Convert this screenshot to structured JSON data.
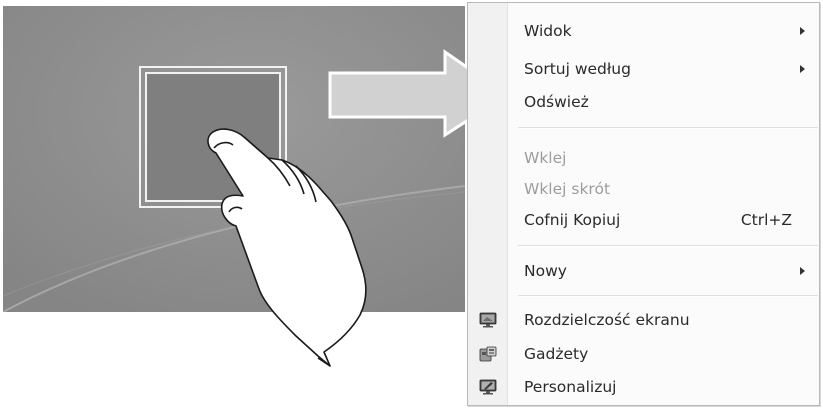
{
  "illustration": {
    "description_icons": [
      "touch-hand-icon",
      "arrow-right-icon"
    ]
  },
  "context_menu": {
    "items": [
      {
        "label": "Widok",
        "has_submenu": true,
        "enabled": true
      },
      {
        "label": "Sortuj według",
        "has_submenu": true,
        "enabled": true
      },
      {
        "label": "Odśwież",
        "has_submenu": false,
        "enabled": true
      },
      {
        "label": "Wklej",
        "has_submenu": false,
        "enabled": false
      },
      {
        "label": "Wklej skrót",
        "has_submenu": false,
        "enabled": false
      },
      {
        "label": "Cofnij Kopiuj",
        "shortcut": "Ctrl+Z",
        "has_submenu": false,
        "enabled": true
      },
      {
        "label": "Nowy",
        "has_submenu": true,
        "enabled": true
      },
      {
        "label": "Rozdzielczość ekranu",
        "icon": "screen-resolution-icon",
        "enabled": true
      },
      {
        "label": "Gadżety",
        "icon": "gadgets-icon",
        "enabled": true
      },
      {
        "label": "Personalizuj",
        "icon": "personalize-icon",
        "enabled": true
      }
    ]
  },
  "colors": {
    "menu_background": "#fbfbfb",
    "menu_border": "#b9b9b9",
    "text": "#2a2a2a",
    "disabled_text": "#9d9d9d",
    "desktop_background": "#8b8b8b"
  }
}
